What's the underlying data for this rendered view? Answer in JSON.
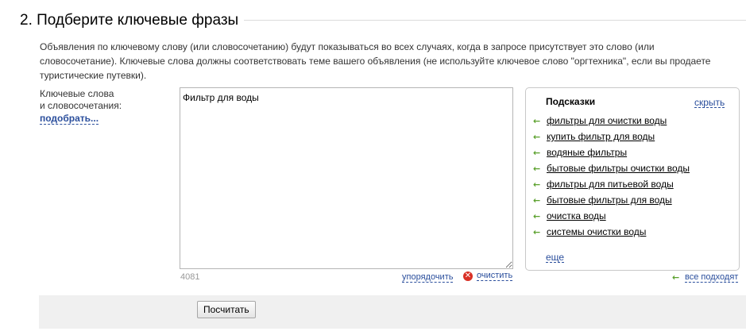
{
  "section": {
    "title": "2. Подберите ключевые фразы",
    "description": "Объявления по ключевому слову (или словосочетанию) будут показываться во всех случаях, когда в запросе присутствует это слово (или словосочетание). Ключевые слова должны соответствовать теме вашего объявления (не используйте ключевое слово \"оргтехника\", если вы продаете туристические путевки)."
  },
  "keywords": {
    "label_line1": "Ключевые слова",
    "label_line2": "и словосочетания:",
    "pick_link": "подобрать...",
    "textarea_value": "Фильтр для воды",
    "char_count": "4081",
    "sort_link": "упорядочить",
    "clear_link": "очистить"
  },
  "hints": {
    "title": "Подсказки",
    "hide_link": "скрыть",
    "items": [
      "фильтры для очистки воды",
      "купить фильтр для воды",
      "водяные фильтры",
      "бытовые фильтры очистки воды",
      "фильтры для питьевой воды",
      "бытовые фильтры для воды",
      "очистка воды",
      "системы очистки воды"
    ],
    "more_link": "еще",
    "all_fit_link": "все подходят"
  },
  "footer": {
    "calculate_button": "Посчитать"
  },
  "icons": {
    "add_arrow": "arrow-left-icon",
    "clear": "clear-x-icon"
  },
  "colors": {
    "link": "#2a4e9c",
    "arrow": "#5aa02c",
    "clear_icon": "#d93025",
    "footer_bg": "#f0f0f0"
  }
}
